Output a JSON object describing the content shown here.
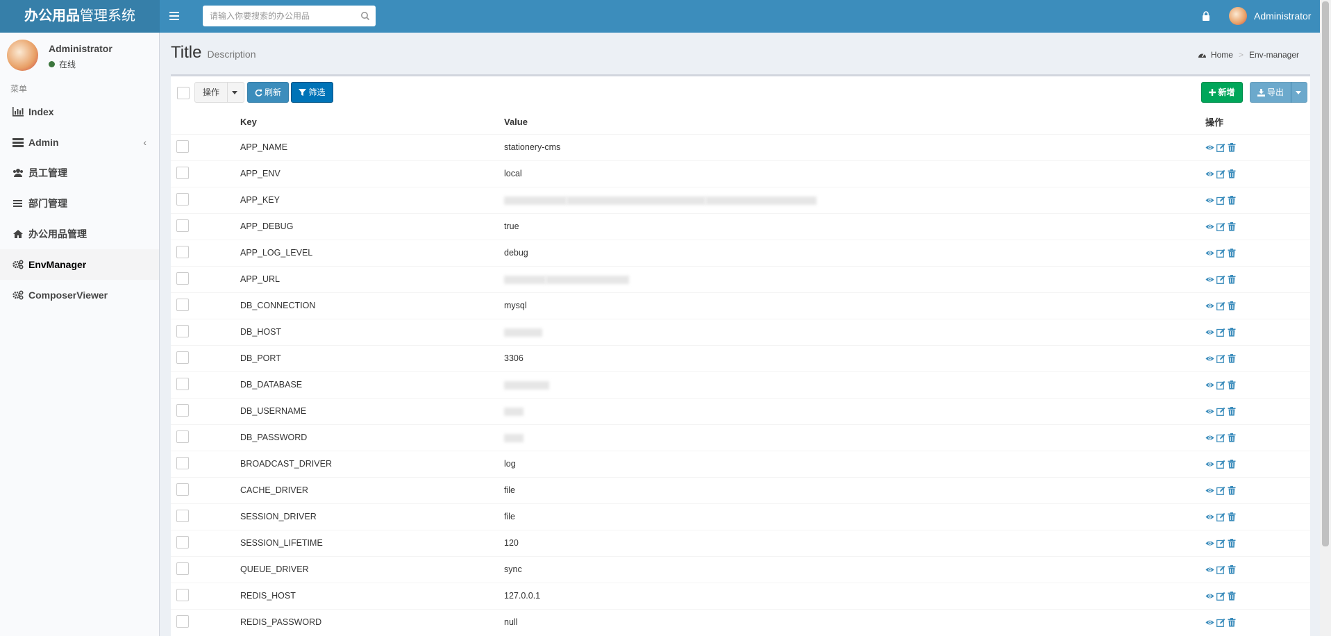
{
  "header": {
    "logo_bold": "办公用品",
    "logo_light": "管理系统",
    "search_placeholder": "请输入你要搜索的办公用品",
    "user_name": "Administrator"
  },
  "sidebar": {
    "user_name": "Administrator",
    "status": "在线",
    "menu_header": "菜单",
    "items": [
      {
        "label": "Index",
        "icon": "bar-chart-icon"
      },
      {
        "label": "Admin",
        "icon": "tasks-icon"
      },
      {
        "label": "员工管理",
        "icon": "users-icon"
      },
      {
        "label": "部门管理",
        "icon": "bars-icon"
      },
      {
        "label": "办公用品管理",
        "icon": "home-icon"
      },
      {
        "label": "EnvManager",
        "icon": "cogs-icon"
      },
      {
        "label": "ComposerViewer",
        "icon": "cogs-icon"
      }
    ]
  },
  "page": {
    "title": "Title",
    "description": "Description",
    "breadcrumb_home": "Home",
    "breadcrumb_current": "Env-manager"
  },
  "toolbar": {
    "op_label": "操作",
    "refresh_label": "刷新",
    "filter_label": "筛选",
    "new_label": "新增",
    "export_label": "导出"
  },
  "table": {
    "headers": {
      "key": "Key",
      "value": "Value",
      "actions": "操作"
    },
    "rows": [
      {
        "key": "APP_NAME",
        "value": "stationery-cms"
      },
      {
        "key": "APP_ENV",
        "value": "local"
      },
      {
        "key": "APP_KEY",
        "value": ""
      },
      {
        "key": "APP_DEBUG",
        "value": "true"
      },
      {
        "key": "APP_LOG_LEVEL",
        "value": "debug"
      },
      {
        "key": "APP_URL",
        "value": ""
      },
      {
        "key": "DB_CONNECTION",
        "value": "mysql"
      },
      {
        "key": "DB_HOST",
        "value": ""
      },
      {
        "key": "DB_PORT",
        "value": "3306"
      },
      {
        "key": "DB_DATABASE",
        "value": ""
      },
      {
        "key": "DB_USERNAME",
        "value": ""
      },
      {
        "key": "DB_PASSWORD",
        "value": ""
      },
      {
        "key": "BROADCAST_DRIVER",
        "value": "log"
      },
      {
        "key": "CACHE_DRIVER",
        "value": "file"
      },
      {
        "key": "SESSION_DRIVER",
        "value": "file"
      },
      {
        "key": "SESSION_LIFETIME",
        "value": "120"
      },
      {
        "key": "QUEUE_DRIVER",
        "value": "sync"
      },
      {
        "key": "REDIS_HOST",
        "value": "127.0.0.1"
      },
      {
        "key": "REDIS_PASSWORD",
        "value": "null"
      }
    ]
  },
  "colors": {
    "header": "#3c8dbc",
    "logo_bg": "#367fa9",
    "success": "#00a65a",
    "primary": "#0073b7",
    "action_icon": "#3c8dbc"
  }
}
